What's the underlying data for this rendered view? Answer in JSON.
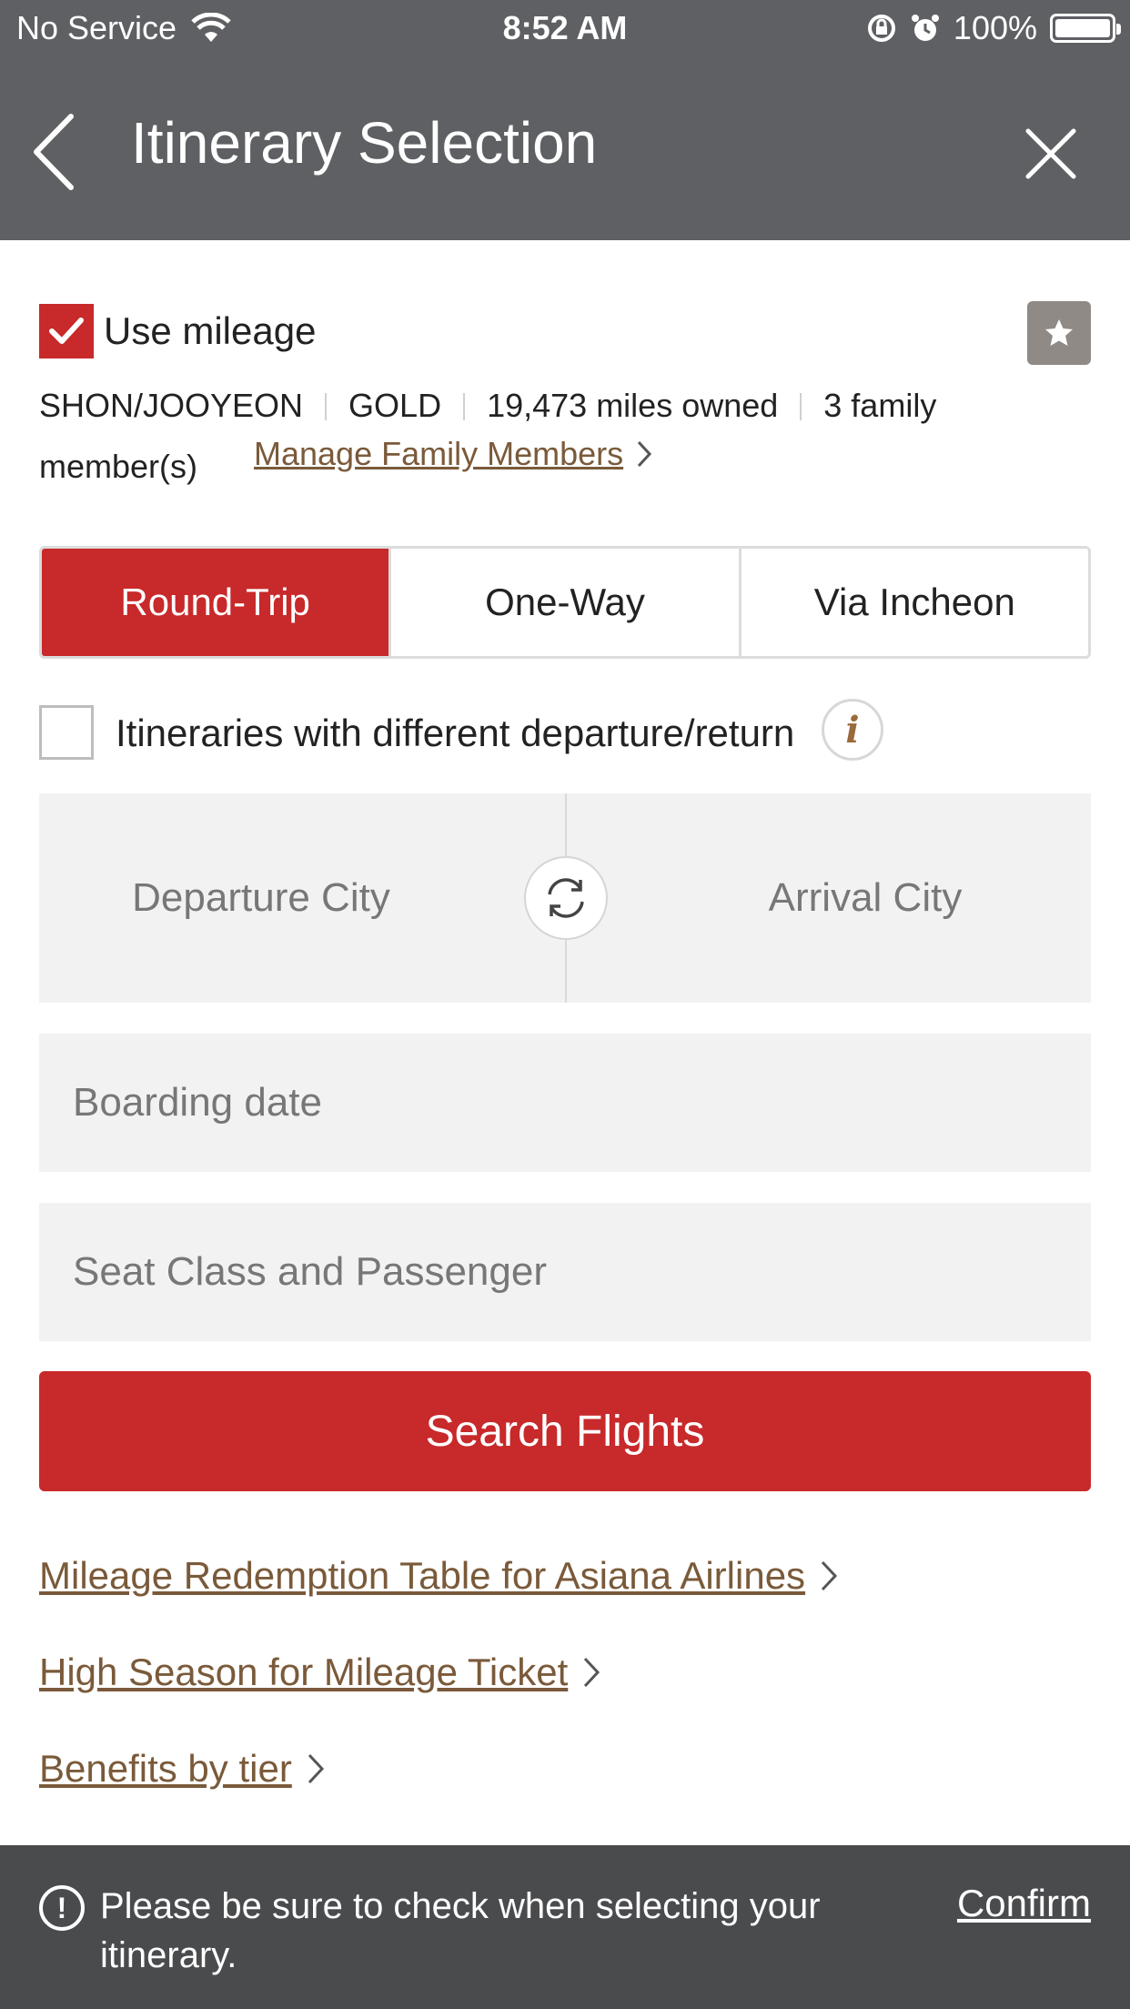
{
  "status_bar": {
    "carrier": "No Service",
    "time": "8:52 AM",
    "battery": "100%"
  },
  "header": {
    "title": "Itinerary Selection"
  },
  "mileage": {
    "use_mileage_label": "Use mileage",
    "use_mileage_checked": true,
    "member_name": "SHON/JOOYEON",
    "tier": "GOLD",
    "miles": "19,473 miles owned",
    "family": "3 family member(s)",
    "manage_link": "Manage Family Members"
  },
  "trip_tabs": {
    "items": [
      "Round-Trip",
      "One-Way",
      "Via Incheon"
    ],
    "selected": "Round-Trip"
  },
  "different_itinerary": {
    "label": "Itineraries with different departure/return",
    "checked": false,
    "info_glyph": "i"
  },
  "route": {
    "departure_placeholder": "Departure City",
    "arrival_placeholder": "Arrival City"
  },
  "fields": {
    "boarding_date_placeholder": "Boarding date",
    "seat_class_placeholder": "Seat Class and Passenger"
  },
  "actions": {
    "search_label": "Search Flights"
  },
  "links": {
    "redemption_table": "Mileage Redemption Table for Asiana Airlines",
    "high_season": "High Season for Mileage Ticket",
    "benefits": "Benefits by tier"
  },
  "notice": {
    "glyph": "!",
    "message": "Please be sure to check when selecting your itinerary.",
    "confirm_label": "Confirm"
  },
  "colors": {
    "brand_red": "#c8292a",
    "header_gray": "#5f6063",
    "link_brown": "#7a5a3a",
    "notice_gray": "#4a4b4d"
  }
}
